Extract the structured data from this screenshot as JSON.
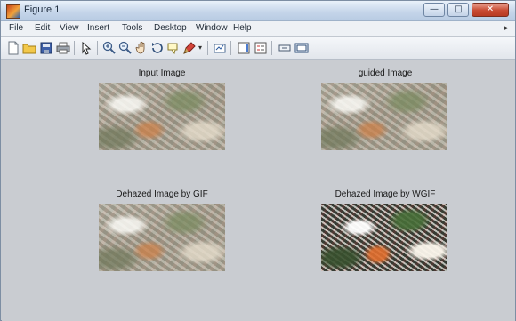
{
  "window": {
    "title": "Figure 1",
    "controls": {
      "minimize": "—",
      "maximize": "□",
      "close": "✕"
    }
  },
  "menubar": {
    "items": [
      {
        "label": "File",
        "icon": ""
      },
      {
        "label": "Edit",
        "icon": ""
      },
      {
        "label": "View",
        "icon": ""
      },
      {
        "label": "Insert",
        "icon": ""
      },
      {
        "label": "Tools",
        "icon": ""
      },
      {
        "label": "Desktop",
        "icon": ""
      },
      {
        "label": "Window",
        "icon": ""
      },
      {
        "label": "Help",
        "icon": ""
      }
    ],
    "overflow_arrow": "▸"
  },
  "toolbar": {
    "icons": [
      "new-figure-icon",
      "open-file-icon",
      "save-icon",
      "print-icon",
      "edit-plot-icon",
      "zoom-in-icon",
      "zoom-out-icon",
      "pan-icon",
      "rotate-3d-icon",
      "data-cursor-icon",
      "brush-icon",
      "brush-dropdown-icon",
      "link-plot-icon",
      "insert-colorbar-icon",
      "insert-legend-icon",
      "hide-plot-tools-icon",
      "show-plot-tools-icon"
    ]
  },
  "figure": {
    "panels": [
      {
        "title": "Input Image",
        "kind": "hazy"
      },
      {
        "title": "guided Image",
        "kind": "hazy"
      },
      {
        "title": "Dehazed Image by GIF",
        "kind": "hazy"
      },
      {
        "title": "Dehazed Image by WGIF",
        "kind": "dehazed"
      }
    ]
  }
}
